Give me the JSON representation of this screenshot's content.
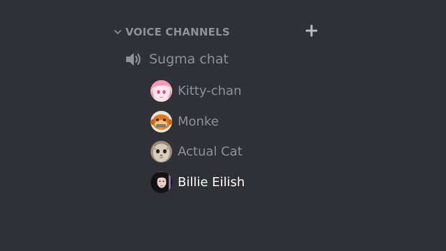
{
  "category": {
    "label": "VOICE CHANNELS",
    "chevron_icon": "chevron-down-icon",
    "add_icon": "plus-icon"
  },
  "channel": {
    "name": "Sugma chat",
    "icon": "speaker-icon"
  },
  "users": [
    {
      "name": "Kitty-chan",
      "avatar": "anime-girl-pink-hair",
      "active": false
    },
    {
      "name": "Monke",
      "avatar": "monkey",
      "active": false
    },
    {
      "name": "Actual Cat",
      "avatar": "cat-face",
      "active": false
    },
    {
      "name": "Billie Eilish",
      "avatar": "person-dark-hair",
      "active": true
    }
  ],
  "colors": {
    "background": "#2f3136",
    "muted_text": "#8e9297",
    "active_text": "#ffffff"
  }
}
